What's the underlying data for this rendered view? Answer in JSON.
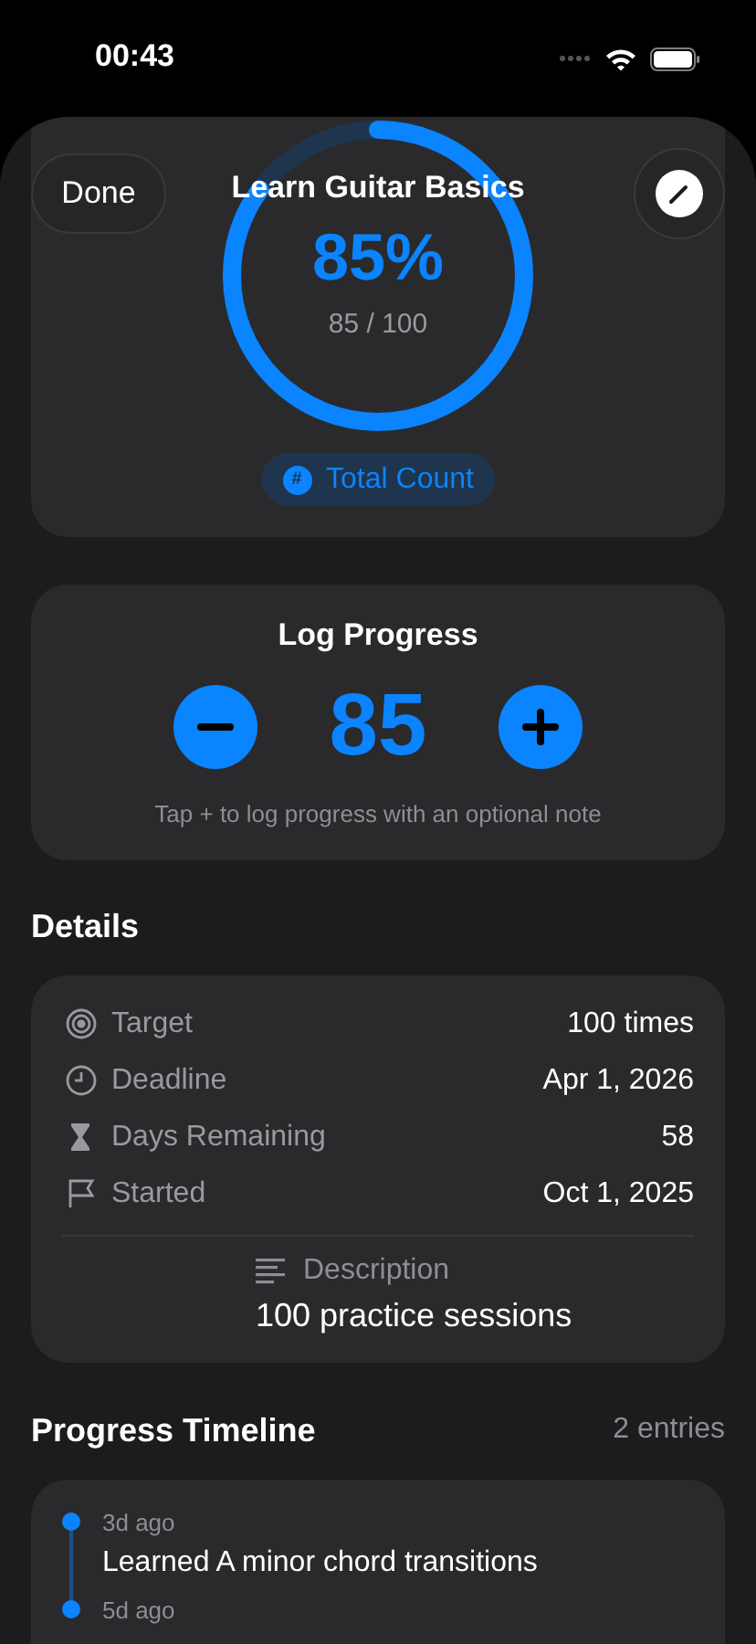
{
  "status_bar": {
    "time": "00:43"
  },
  "header": {
    "done": "Done",
    "title": "Learn Guitar Basics"
  },
  "progress": {
    "percent": "85%",
    "count": "85 / 100",
    "level": 0.85,
    "badge": {
      "icon": "#",
      "label": "Total Count"
    }
  },
  "log": {
    "title": "Log Progress",
    "value": "85",
    "hint": "Tap + to log progress with an optional note"
  },
  "details": {
    "title": "Details",
    "rows": [
      {
        "kind": "target",
        "label": "Target",
        "value": "100 times"
      },
      {
        "kind": "deadline",
        "label": "Deadline",
        "value": "Apr 1, 2026"
      },
      {
        "kind": "remaining",
        "label": "Days Remaining",
        "value": "58"
      },
      {
        "kind": "started",
        "label": "Started",
        "value": "Oct 1, 2025"
      }
    ],
    "description": {
      "label": "Description",
      "text": "100 practice sessions"
    }
  },
  "timeline": {
    "title": "Progress Timeline",
    "count": "2 entries",
    "entries": [
      {
        "time": "3d ago",
        "note": "Learned A minor chord transitions"
      },
      {
        "time": "5d ago"
      }
    ]
  }
}
